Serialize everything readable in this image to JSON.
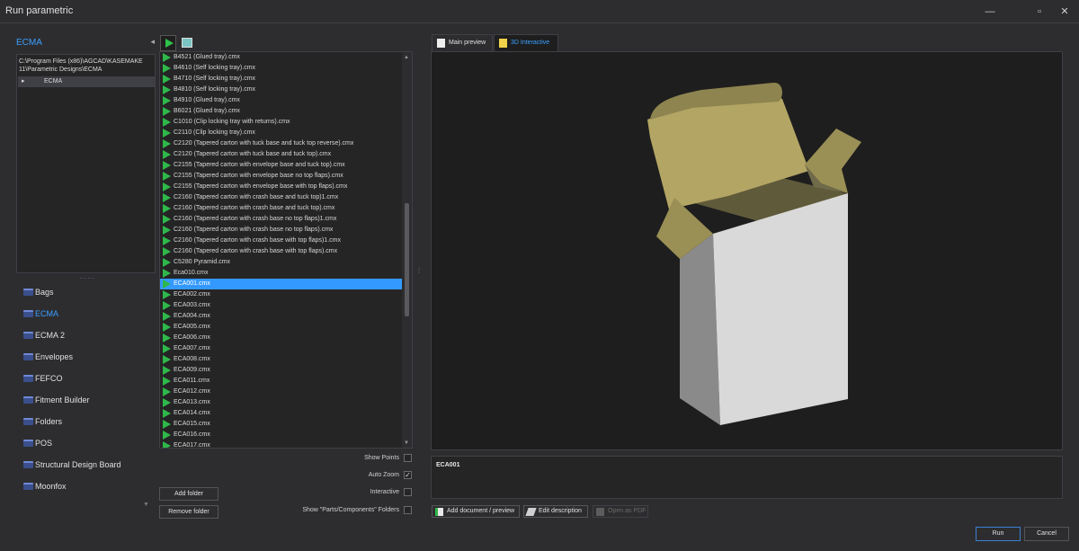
{
  "window": {
    "title": "Run parametric",
    "controls": [
      "—",
      "▫",
      "✕"
    ]
  },
  "left_panel": {
    "header": "ECMA",
    "collapse_glyph": "◂",
    "tree_path": "C:\\Program Files (x86)\\AGCAD\\KASEMAKE 11\\Parametric Designs\\ECMA",
    "tree_node": "ECMA",
    "categories": [
      {
        "label": "Bags"
      },
      {
        "label": "ECMA",
        "active": true
      },
      {
        "label": "ECMA 2"
      },
      {
        "label": "Envelopes"
      },
      {
        "label": "FEFCO"
      },
      {
        "label": "Fitment Builder"
      },
      {
        "label": "Folders"
      },
      {
        "label": "POS"
      },
      {
        "label": "Structural Design Board"
      },
      {
        "label": "Moonfox"
      }
    ]
  },
  "files": [
    "B4521 (Glued tray).cmx",
    "B4610 (Self locking tray).cmx",
    "B4710 (Self locking tray).cmx",
    "B4810 (Self locking tray).cmx",
    "B4910 (Glued tray).cmx",
    "B6021 (Glued tray).cmx",
    "C1010 (Clip locking tray with returns).cmx",
    "C2110 (Clip locking tray).cmx",
    "C2120 (Tapered carton with tuck base and tuck top reverse).cmx",
    "C2120 (Tapered carton with tuck base and tuck top).cmx",
    "C2155 (Tapered carton with envelope base and tuck top).cmx",
    "C2155 (Tapered carton with envelope base no top flaps).cmx",
    "C2155 (Tapered carton with envelope base with top flaps).cmx",
    "C2160 (Tapered carton with crash base and tuck top)1.cmx",
    "C2160 (Tapered carton with crash base and tuck top).cmx",
    "C2160 (Tapered carton with crash base no top flaps)1.cmx",
    "C2160 (Tapered carton with crash base no top flaps).cmx",
    "C2160 (Tapered carton with crash base with top flaps)1.cmx",
    "C2160 (Tapered carton with crash base with top flaps).cmx",
    "C5280 Pyramid.cmx",
    "Eca010.cmx",
    "ECA001.cmx",
    "ECA002.cmx",
    "ECA003.cmx",
    "ECA004.cmx",
    "ECA005.cmx",
    "ECA006.cmx",
    "ECA007.cmx",
    "ECA008.cmx",
    "ECA009.cmx",
    "ECA011.cmx",
    "ECA012.cmx",
    "ECA013.cmx",
    "ECA014.cmx",
    "ECA015.cmx",
    "ECA016.cmx",
    "ECA017.cmx"
  ],
  "selected_file": "ECA001.cmx",
  "options": {
    "show_points": {
      "label": "Show Points",
      "checked": false
    },
    "auto_zoom": {
      "label": "Auto Zoom",
      "checked": true
    },
    "interactive": {
      "label": "Interactive",
      "checked": false
    },
    "show_parts": {
      "label": "Show \"Parts/Components\" Folders",
      "checked": false
    }
  },
  "buttons": {
    "add_folder": "Add folder",
    "remove_folder": "Remove folder",
    "add_document": "Add document / preview",
    "edit_description": "Edit description",
    "open_pdf": "Open as PDF",
    "run": "Run",
    "cancel": "Cancel"
  },
  "tabs": [
    {
      "label": "Main preview",
      "active": false
    },
    {
      "label": "3D Interactive",
      "active": true
    }
  ],
  "description": {
    "name": "ECA001"
  },
  "colors": {
    "accent": "#3ca0ff",
    "selection": "#3399ff",
    "run_arrow": "#2fb84a",
    "box_kraft": "#b3a564",
    "box_kraft_dark": "#807545",
    "box_white": "#d9d9d9",
    "box_side": "#8a8a8a"
  }
}
